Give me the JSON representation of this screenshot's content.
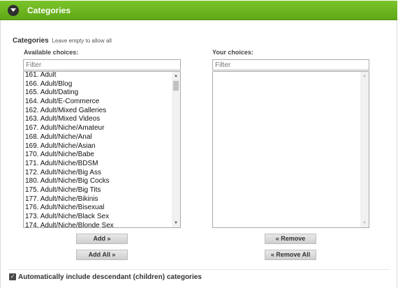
{
  "header": {
    "title": "Categories",
    "toggle_icon": "chevron-down-icon"
  },
  "field": {
    "label": "Categories",
    "hint": "Leave empty to allow all"
  },
  "available": {
    "heading": "Available choices:",
    "filter_placeholder": "Filter",
    "items": [
      "161. Adult",
      "166. Adult/Blog",
      "165. Adult/Dating",
      "164. Adult/E-Commerce",
      "162. Adult/Mixed Galleries",
      "163. Adult/Mixed Videos",
      "167. Adult/Niche/Amateur",
      "168. Adult/Niche/Anal",
      "169. Adult/Niche/Asian",
      "170. Adult/Niche/Babe",
      "171. Adult/Niche/BDSM",
      "172. Adult/Niche/Big Ass",
      "180. Adult/Niche/Big Cocks",
      "175. Adult/Niche/Big Tits",
      "177. Adult/Niche/Bikinis",
      "176. Adult/Niche/Bisexual",
      "173. Adult/Niche/Black Sex",
      "174. Adult/Niche/Blonde Sex"
    ],
    "add_label": "Add »",
    "add_all_label": "Add All »"
  },
  "chosen": {
    "heading": "Your choices:",
    "filter_placeholder": "Filter",
    "items": [],
    "remove_label": "« Remove",
    "remove_all_label": "« Remove All"
  },
  "descendants": {
    "label": "Automatically include descendant (children) categories",
    "checked": true
  },
  "colors": {
    "header_green": "#6bb820",
    "toggle_dark": "#2f2f2f"
  }
}
